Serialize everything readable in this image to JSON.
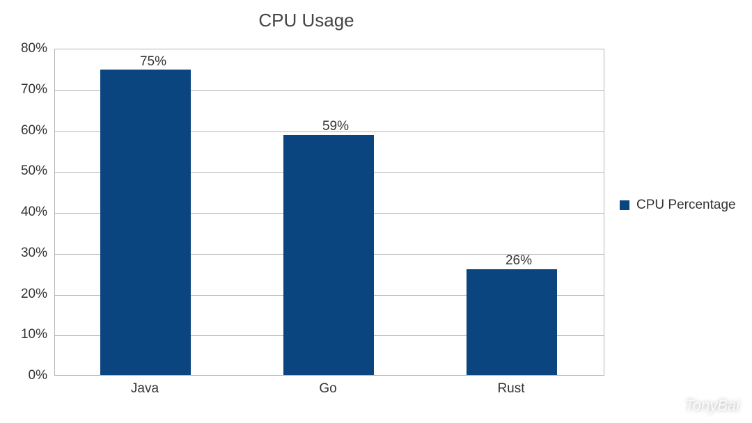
{
  "chart_data": {
    "type": "bar",
    "title": "CPU Usage",
    "categories": [
      "Java",
      "Go",
      "Rust"
    ],
    "values": [
      75,
      59,
      26
    ],
    "value_labels": [
      "75%",
      "59%",
      "26%"
    ],
    "series_name": "CPU Percentage",
    "ylim": [
      0,
      80
    ],
    "y_ticks": [
      0,
      10,
      20,
      30,
      40,
      50,
      60,
      70,
      80
    ],
    "y_tick_labels": [
      "0%",
      "10%",
      "20%",
      "30%",
      "40%",
      "50%",
      "60%",
      "70%",
      "80%"
    ],
    "bar_color": "#0b4580",
    "grid": true,
    "legend_position": "right"
  },
  "watermark": {
    "text": "TonyBai"
  }
}
